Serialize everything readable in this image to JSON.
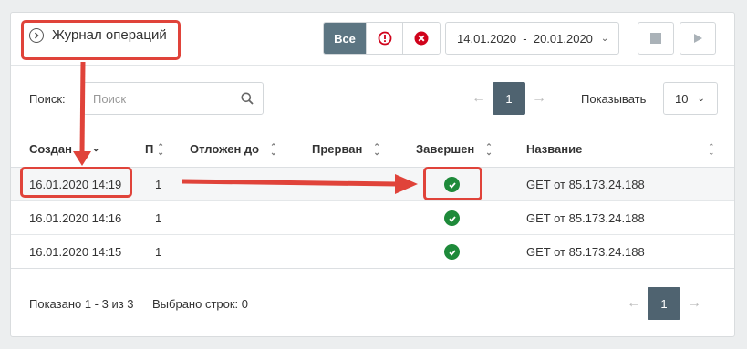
{
  "header": {
    "title": "Журнал операций",
    "filters": [
      {
        "label": "Все",
        "active": true
      },
      {
        "icon": "warning-circle-icon",
        "color": "#d0021b"
      },
      {
        "icon": "error-circle-icon",
        "color": "#d0021b"
      }
    ],
    "date_range": "14.01.2020  -  20.01.2020",
    "controls": [
      "stop-icon",
      "play-icon"
    ]
  },
  "toolbar": {
    "search_label": "Поиск:",
    "search_placeholder": "Поиск",
    "search_value": "",
    "page_current": "1",
    "show_label": "Показывать",
    "page_size": "10"
  },
  "table": {
    "columns": [
      "Создан",
      "П",
      "Отложен до",
      "Прерван",
      "Завершен",
      "Название"
    ],
    "rows": [
      {
        "created": "16.01.2020 14:19",
        "p": "1",
        "deferred": "",
        "aborted": "",
        "completed": true,
        "name": "GET от 85.173.24.188"
      },
      {
        "created": "16.01.2020 14:16",
        "p": "1",
        "deferred": "",
        "aborted": "",
        "completed": true,
        "name": "GET от 85.173.24.188"
      },
      {
        "created": "16.01.2020 14:15",
        "p": "1",
        "deferred": "",
        "aborted": "",
        "completed": true,
        "name": "GET от 85.173.24.188"
      }
    ]
  },
  "footer": {
    "shown": "Показано 1 - 3 из 3",
    "selected": "Выбрано строк: 0",
    "page_current": "1"
  },
  "colors": {
    "accent": "#5c7582",
    "pager_active": "#4f6370",
    "success": "#1e8a3a",
    "annotation": "#e0433a"
  }
}
